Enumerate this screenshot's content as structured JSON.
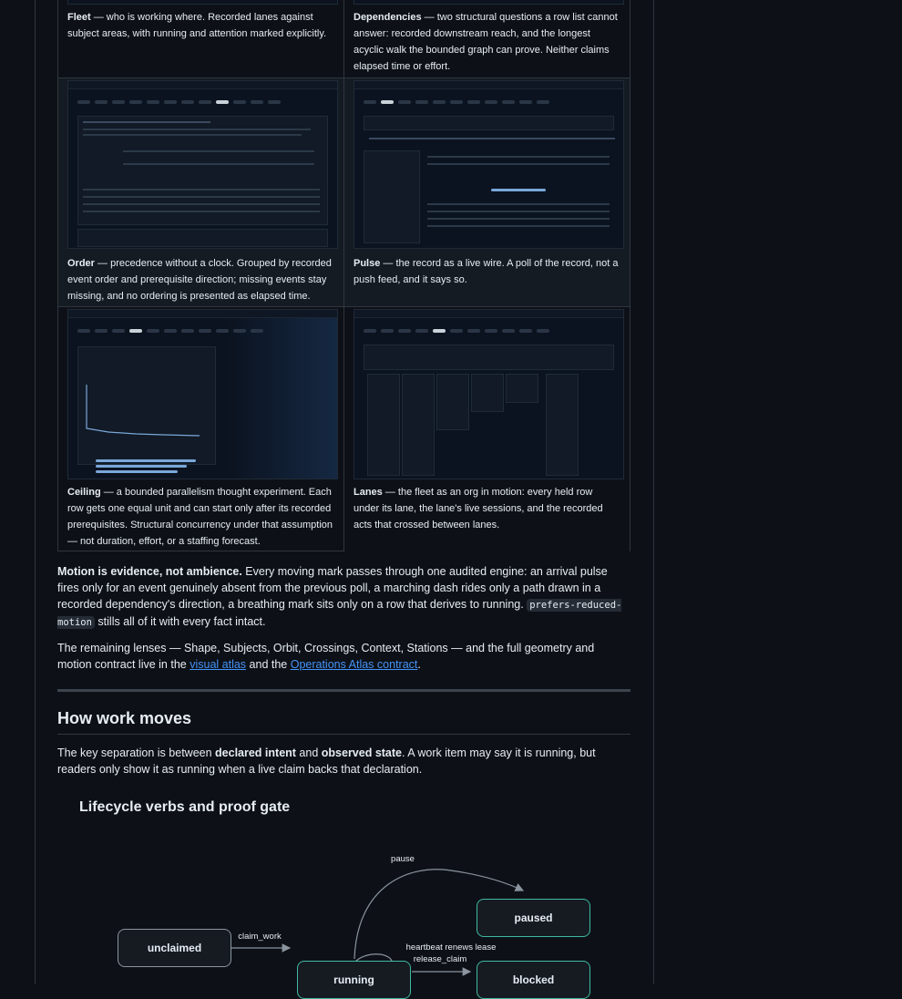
{
  "cards": [
    {
      "key": "fleet",
      "title": "Fleet",
      "body": " — who is working where. Recorded lanes against subject areas, with running and attention marked explicitly."
    },
    {
      "key": "dependencies",
      "title": "Dependencies",
      "body": " — two structural questions a row list cannot answer: recorded downstream reach, and the longest acyclic walk the bounded graph can prove. Neither claims elapsed time or effort."
    },
    {
      "key": "order",
      "title": "Order",
      "body": " — precedence without a clock. Grouped by recorded event order and prerequisite direction; missing events stay missing, and no ordering is presented as elapsed time."
    },
    {
      "key": "pulse",
      "title": "Pulse",
      "body": " — the record as a live wire. A poll of the record, not a push feed, and it says so."
    },
    {
      "key": "ceiling",
      "title": "Ceiling",
      "body": " — a bounded parallelism thought experiment. Each row gets one equal unit and can start only after its recorded prerequisites. Structural concurrency under that assumption — not duration, effort, or a staffing forecast."
    },
    {
      "key": "lanes",
      "title": "Lanes",
      "body": " — the fleet as an org in motion: every held row under its lane, the lane's live sessions, and the recorded acts that crossed between lanes."
    }
  ],
  "motion": {
    "lead": "Motion is evidence, not ambience.",
    "text": " Every moving mark passes through one audited engine: an arrival pulse fires only for an event genuinely absent from the previous poll, a marching dash rides only a path drawn in a recorded dependency's direction, a breathing mark sits only on a row that derives to running. ",
    "code": "prefers-reduced-motion",
    "tail": " stills all of it with every fact intact."
  },
  "lenses": {
    "text": "The remaining lenses — Shape, Subjects, Orbit, Crossings, Context, Stations — and the full geometry and motion contract live in the ",
    "link1": "visual atlas",
    "mid": " and the ",
    "link2": "Operations Atlas contract",
    "end": "."
  },
  "section": {
    "heading": "How work moves",
    "p1": "The key separation is between ",
    "b1": "declared intent",
    "p2": " and ",
    "b2": "observed state",
    "p3": ". A work item may say it is running, but readers only show it as running when a live claim backs that declaration."
  },
  "diagram": {
    "title": "Lifecycle verbs and proof gate",
    "nodes": {
      "unclaimed": "unclaimed",
      "running": "running",
      "paused": "paused",
      "blocked": "blocked"
    },
    "edges": {
      "claim_work": "claim_work",
      "pause": "pause",
      "heartbeat": "heartbeat renews lease",
      "release": "release_claim"
    }
  },
  "colors": {
    "background": "#0d1117",
    "border": "#30363d",
    "link": "#4493f8",
    "teal": "#3fb9a0"
  }
}
